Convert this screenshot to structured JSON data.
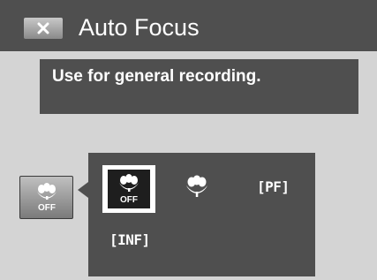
{
  "header": {
    "close_icon": "close-x-icon",
    "title": "Auto Focus"
  },
  "description": {
    "text": "Use for general recording."
  },
  "current_mode": {
    "icon": "macro-off-icon",
    "label": "OFF"
  },
  "options_panel": {
    "selected_index": 0,
    "options": [
      {
        "name": "macro-off",
        "icon": "macro-off-icon",
        "label": "OFF"
      },
      {
        "name": "macro",
        "icon": "macro-icon",
        "label": ""
      },
      {
        "name": "pan-focus",
        "icon": "pan-focus-icon",
        "label": "[PF]"
      },
      {
        "name": "infinity",
        "icon": "infinity-focus-icon",
        "label": "[INF]"
      }
    ]
  },
  "colors": {
    "bar": "#4f4f4f",
    "background": "#d4d4d4",
    "text": "#ffffff",
    "selected_highlight": "#ffffff"
  }
}
